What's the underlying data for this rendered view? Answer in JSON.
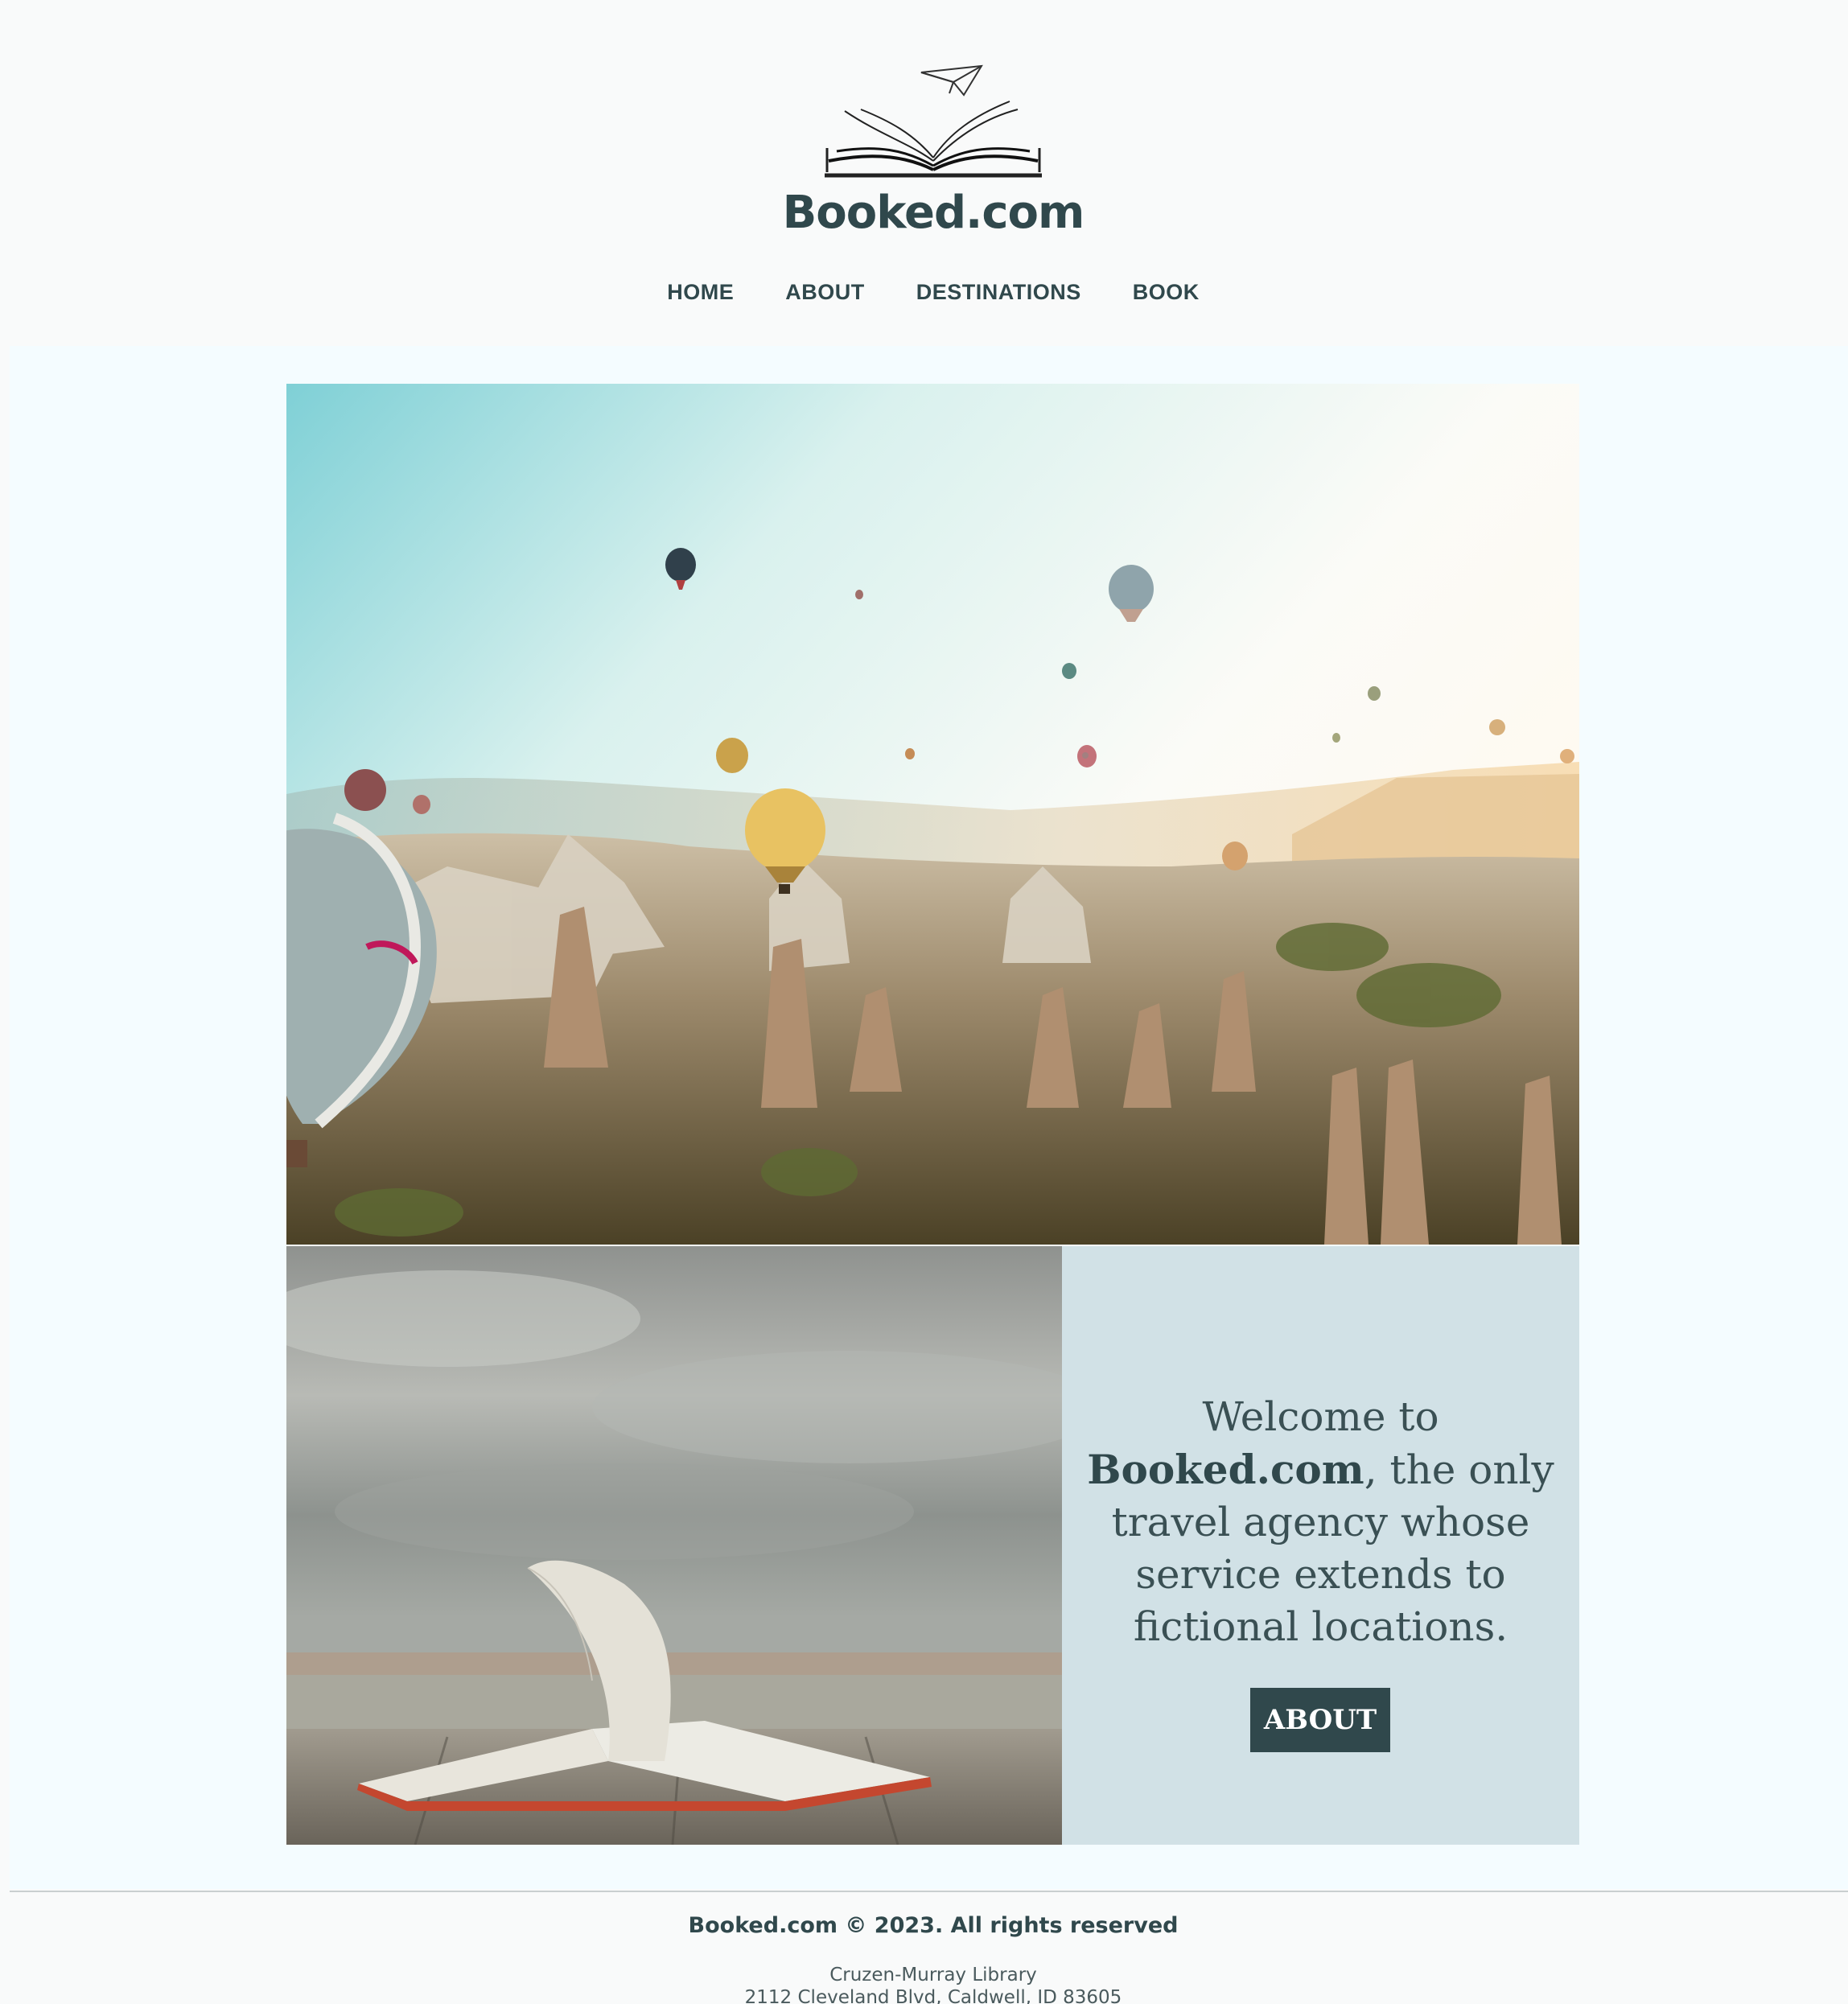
{
  "brand": {
    "name": "Booked.com"
  },
  "nav": {
    "items": [
      {
        "label": "HOME"
      },
      {
        "label": "ABOUT"
      },
      {
        "label": "DESTINATIONS"
      },
      {
        "label": "BOOK"
      }
    ]
  },
  "hero": {
    "image": "hot-air-balloons-over-rock-valley"
  },
  "feature": {
    "image": "open-book-on-pier",
    "welcome_prefix": "Welcome to",
    "welcome_brand": "Booked.com",
    "welcome_rest": ", the only travel agency whose service extends to fictional locations.",
    "button_label": "ABOUT"
  },
  "footer": {
    "copyright": "Booked.com © 2023. All rights reserved",
    "address_line1": "Cruzen-Murray Library",
    "address_line2": "2112 Cleveland Blvd, Caldwell, ID 83605"
  },
  "colors": {
    "primary": "#30484c",
    "band": "#f4fcff",
    "panel": "#d1e1e6",
    "page": "#f9fafa"
  }
}
